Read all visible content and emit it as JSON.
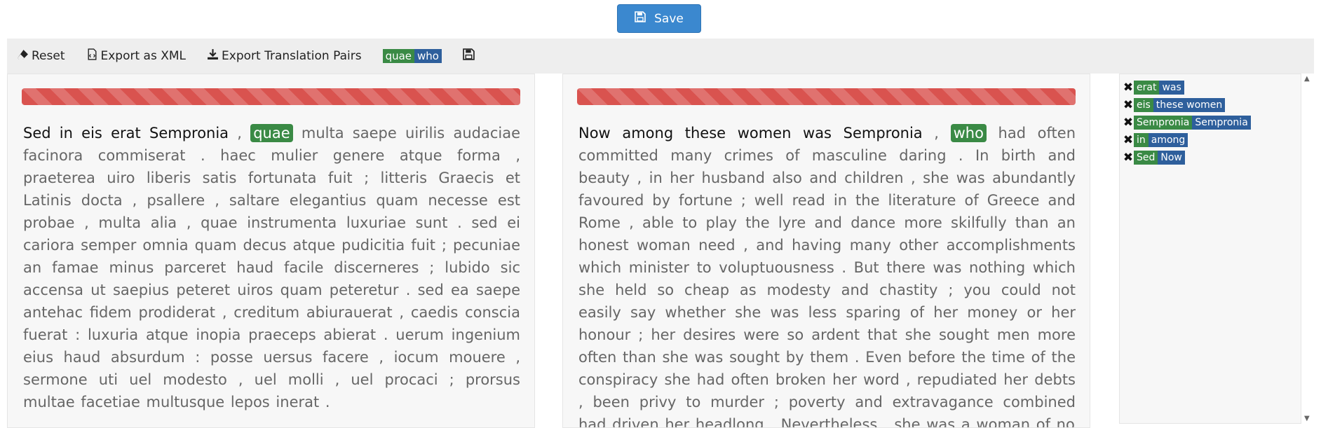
{
  "save_button": {
    "label": "Save"
  },
  "toolbar": {
    "reset": "Reset",
    "export_xml": "Export as XML",
    "export_pairs": "Export Translation Pairs",
    "selected_pair": {
      "source": "quae",
      "target": "who"
    }
  },
  "left_text": {
    "aligned_prefix": "Sed in eis erat Sempronia",
    "pre_hl": " , ",
    "highlight": "quae",
    "rest": " multa saepe uirilis audaciae facinora commiserat . haec mulier genere atque forma , praeterea uiro liberis satis fortunata fuit ; litteris Graecis et Latinis docta , psallere , saltare elegantius quam necesse est probae , multa alia , quae instrumenta luxuriae sunt . sed ei cariora semper omnia quam decus atque pudicitia fuit ; pecuniae an famae minus parceret haud facile discerneres ; lubido sic accensa ut saepius peteret uiros quam peteretur . sed ea saepe antehac fidem prodiderat , creditum abiurauerat , caedis conscia fuerat : luxuria atque inopia praeceps abierat . uerum ingenium eius haud absurdum : posse uersus facere , iocum mouere , sermone uti uel modesto , uel molli , uel procaci ; prorsus multae facetiae multusque lepos inerat ."
  },
  "right_text": {
    "aligned_prefix": "Now among these women was Sempronia",
    "pre_hl": " , ",
    "highlight": "who",
    "rest": " had often committed many crimes of masculine daring . In birth and beauty , in her husband also and children , she was abundantly favoured by fortune ; well read in the literature of Greece and Rome , able to play the lyre and dance more skilfully than an honest woman need , and having many other accomplishments which minister to voluptuousness . But there was nothing which she held so cheap as modesty and chastity ; you could not easily say whether she was less sparing of her money or her honour ; her desires were so ardent that she sought men more often than she was sought by them . Even before the time of the conspiracy she had often broken her word , repudiated her debts , been privy to murder ; poverty and extravagance combined had driven her headlong . Nevertheless , she was a woman of no"
  },
  "alignments": [
    {
      "source": "erat",
      "target": "was"
    },
    {
      "source": "eis",
      "target": "these women"
    },
    {
      "source": "Sempronia",
      "target": "Sempronia"
    },
    {
      "source": "in",
      "target": "among"
    },
    {
      "source": "Sed",
      "target": "Now"
    }
  ],
  "colors": {
    "source_chip": "#3a8a45",
    "target_chip": "#2e5f9c",
    "progress": "#d9534f",
    "save": "#3b88cf"
  }
}
